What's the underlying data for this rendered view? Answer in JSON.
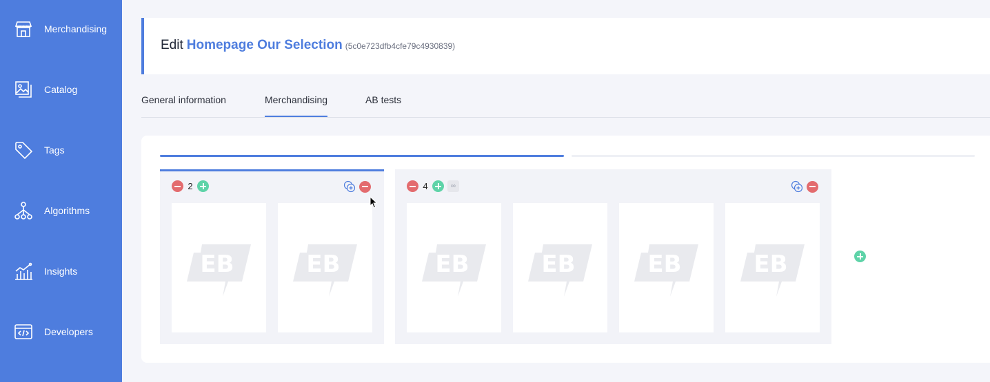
{
  "sidebar": {
    "items": [
      {
        "label": "Merchandising",
        "icon": "store-icon"
      },
      {
        "label": "Catalog",
        "icon": "images-icon"
      },
      {
        "label": "Tags",
        "icon": "tag-icon"
      },
      {
        "label": "Algorithms",
        "icon": "network-icon"
      },
      {
        "label": "Insights",
        "icon": "chart-icon"
      },
      {
        "label": "Developers",
        "icon": "code-icon"
      }
    ]
  },
  "header": {
    "prefix": "Edit",
    "name": "Homepage Our Selection",
    "id": "(5c0e723dfb4cfe79c4930839)"
  },
  "tabs": [
    {
      "label": "General information",
      "active": false
    },
    {
      "label": "Merchandising",
      "active": true
    },
    {
      "label": "AB tests",
      "active": false
    }
  ],
  "rows": [
    {
      "count": "2",
      "slots": 2,
      "selected": true
    },
    {
      "count": "4",
      "slots": 4,
      "selected": false,
      "infinite_label": "∞"
    }
  ],
  "colors": {
    "accent": "#4e7dde",
    "add": "#5ed3a8",
    "remove": "#e36b6e"
  }
}
